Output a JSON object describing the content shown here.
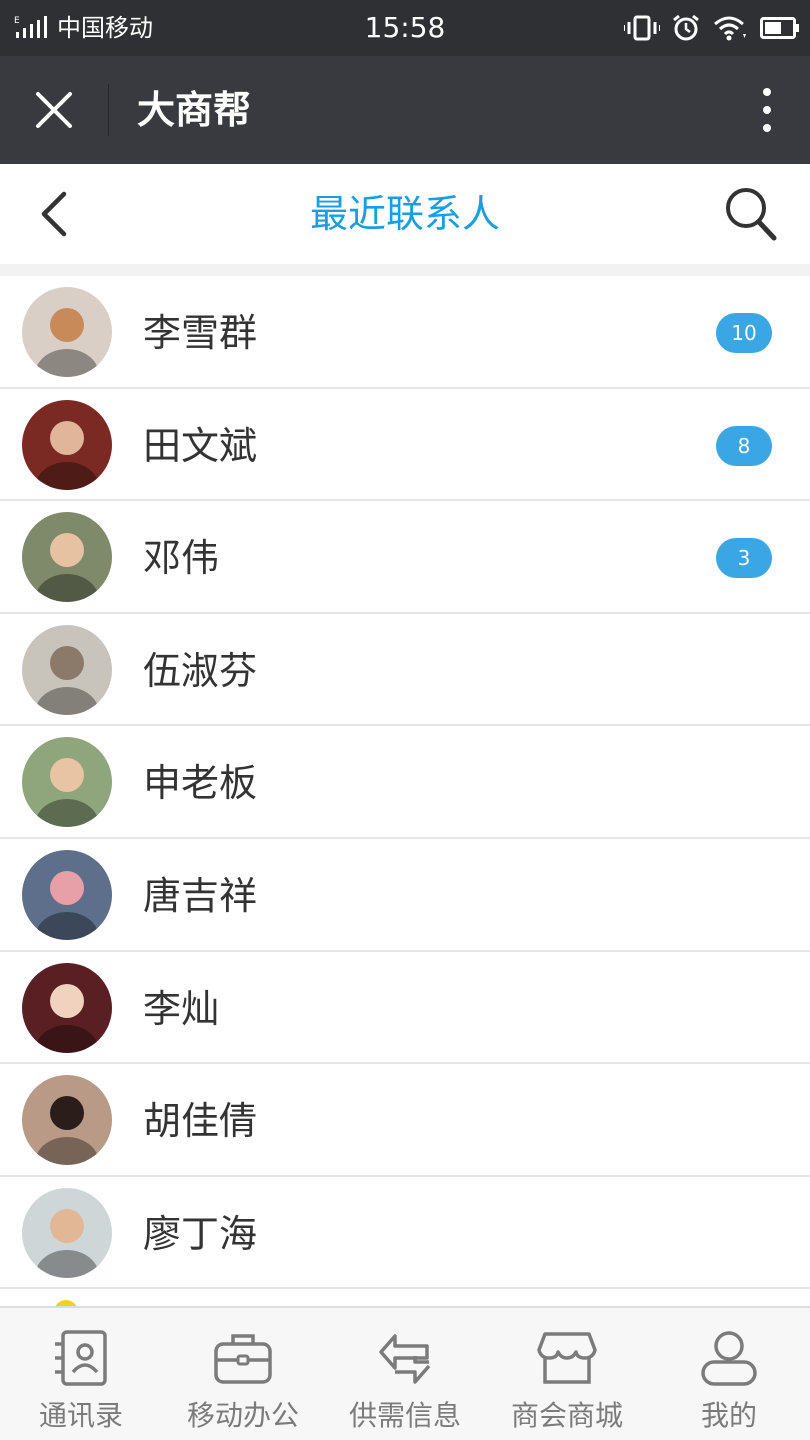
{
  "status_bar": {
    "network_type": "E",
    "carrier": "中国移动",
    "time": "15:58"
  },
  "wechat_bar": {
    "title": "大商帮"
  },
  "header": {
    "title": "最近联系人"
  },
  "contacts": [
    {
      "name": "李雪群",
      "badge": "10",
      "avatar_bg": "#d9cfc7",
      "avatar_fg": "#c98a5a"
    },
    {
      "name": "田文斌",
      "badge": "8",
      "avatar_bg": "#7a2a22",
      "avatar_fg": "#e0b59a"
    },
    {
      "name": "邓伟",
      "badge": "3",
      "avatar_bg": "#7f8a6a",
      "avatar_fg": "#e6c2a2"
    },
    {
      "name": "伍淑芬",
      "badge": "",
      "avatar_bg": "#c9c4bb",
      "avatar_fg": "#8b7a6a"
    },
    {
      "name": "申老板",
      "badge": "",
      "avatar_bg": "#8fa67d",
      "avatar_fg": "#e8c4a5"
    },
    {
      "name": "唐吉祥",
      "badge": "",
      "avatar_bg": "#5d6f8a",
      "avatar_fg": "#e7a0a8"
    },
    {
      "name": "李灿",
      "badge": "",
      "avatar_bg": "#5a1f22",
      "avatar_fg": "#f0d2bf"
    },
    {
      "name": "胡佳倩",
      "badge": "",
      "avatar_bg": "#b89a86",
      "avatar_fg": "#2a1d1a"
    },
    {
      "name": "廖丁海",
      "badge": "",
      "avatar_bg": "#cfd6d8",
      "avatar_fg": "#e2b796"
    }
  ],
  "tabs": [
    {
      "label": "通讯录",
      "icon": "contacts-icon"
    },
    {
      "label": "移动办公",
      "icon": "briefcase-icon"
    },
    {
      "label": "供需信息",
      "icon": "exchange-icon"
    },
    {
      "label": "商会商城",
      "icon": "store-icon"
    },
    {
      "label": "我的",
      "icon": "user-icon"
    }
  ],
  "colors": {
    "accent": "#1a9ee0",
    "badge": "#3aa6e4",
    "status_bar": "#2f3033",
    "wechat_bar": "#393a3f",
    "tab_label": "#7b7b7b"
  }
}
